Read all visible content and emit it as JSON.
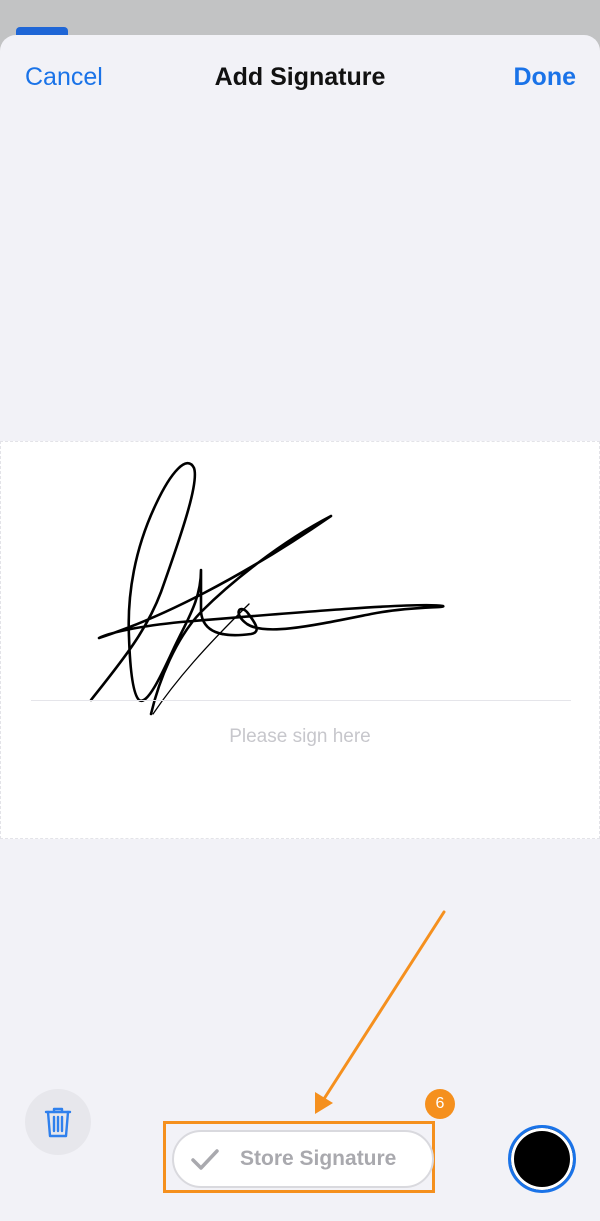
{
  "nav": {
    "cancel_label": "Cancel",
    "title": "Add Signature",
    "done_label": "Done"
  },
  "signature_pad": {
    "hint": "Please sign here"
  },
  "toolbar": {
    "trash_icon": "trash-icon",
    "store_label": "Store Signature",
    "store_icon": "checkmark-icon",
    "pen_color": "#000000"
  },
  "annotation": {
    "step": "6",
    "color": "#f5901e"
  },
  "colors": {
    "accent": "#1a73e8",
    "sheet_background": "#f2f2f7"
  }
}
